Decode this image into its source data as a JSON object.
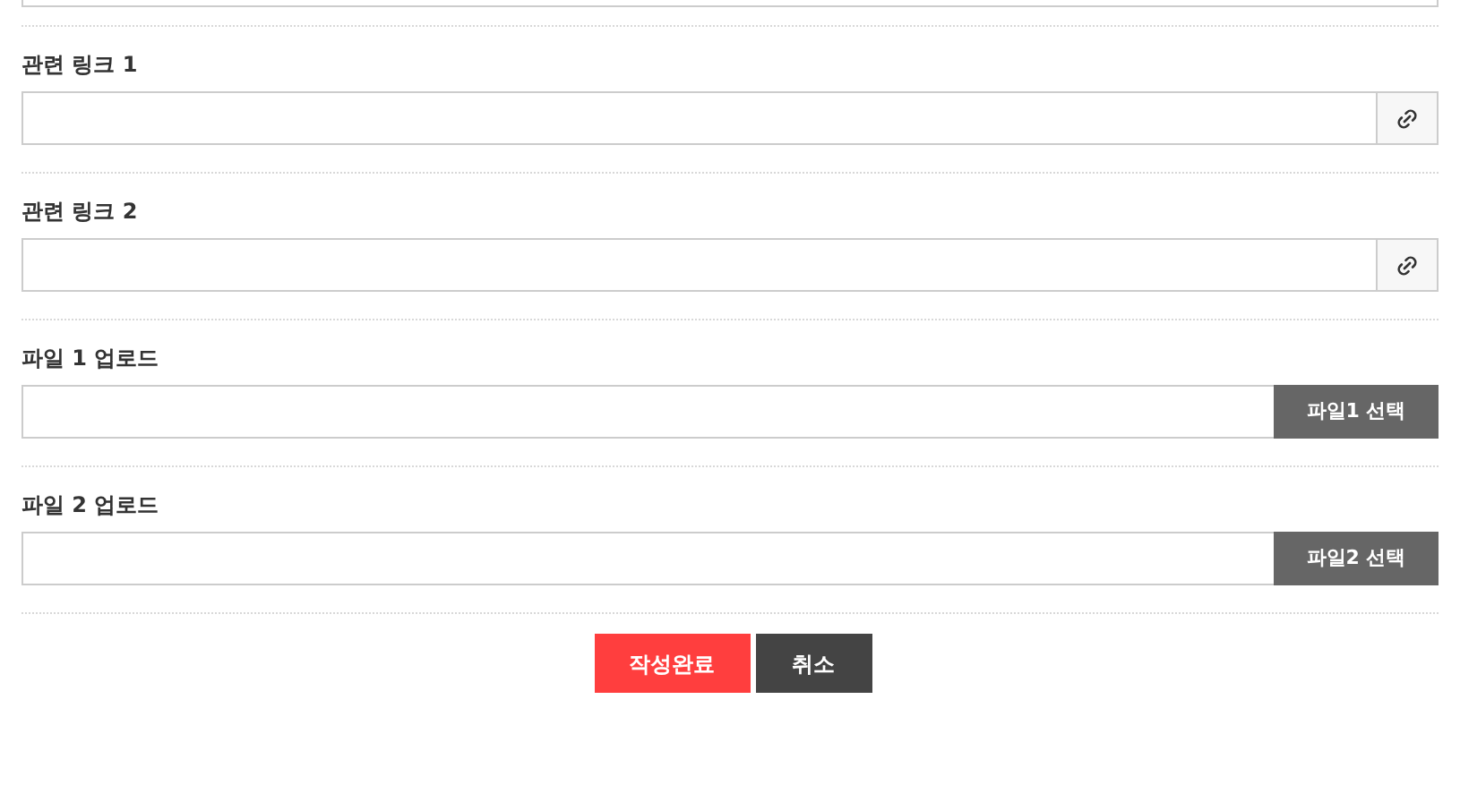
{
  "fields": [
    {
      "kind": "link",
      "label": "관련 링크 1"
    },
    {
      "kind": "link",
      "label": "관련 링크 2"
    },
    {
      "kind": "file",
      "label": "파일 1 업로드",
      "button": "파일1 선택"
    },
    {
      "kind": "file",
      "label": "파일 2 업로드",
      "button": "파일2 선택"
    }
  ],
  "buttons": [
    {
      "kind": "primary",
      "label": "작성완료"
    },
    {
      "kind": "secondary",
      "label": "취소"
    }
  ]
}
